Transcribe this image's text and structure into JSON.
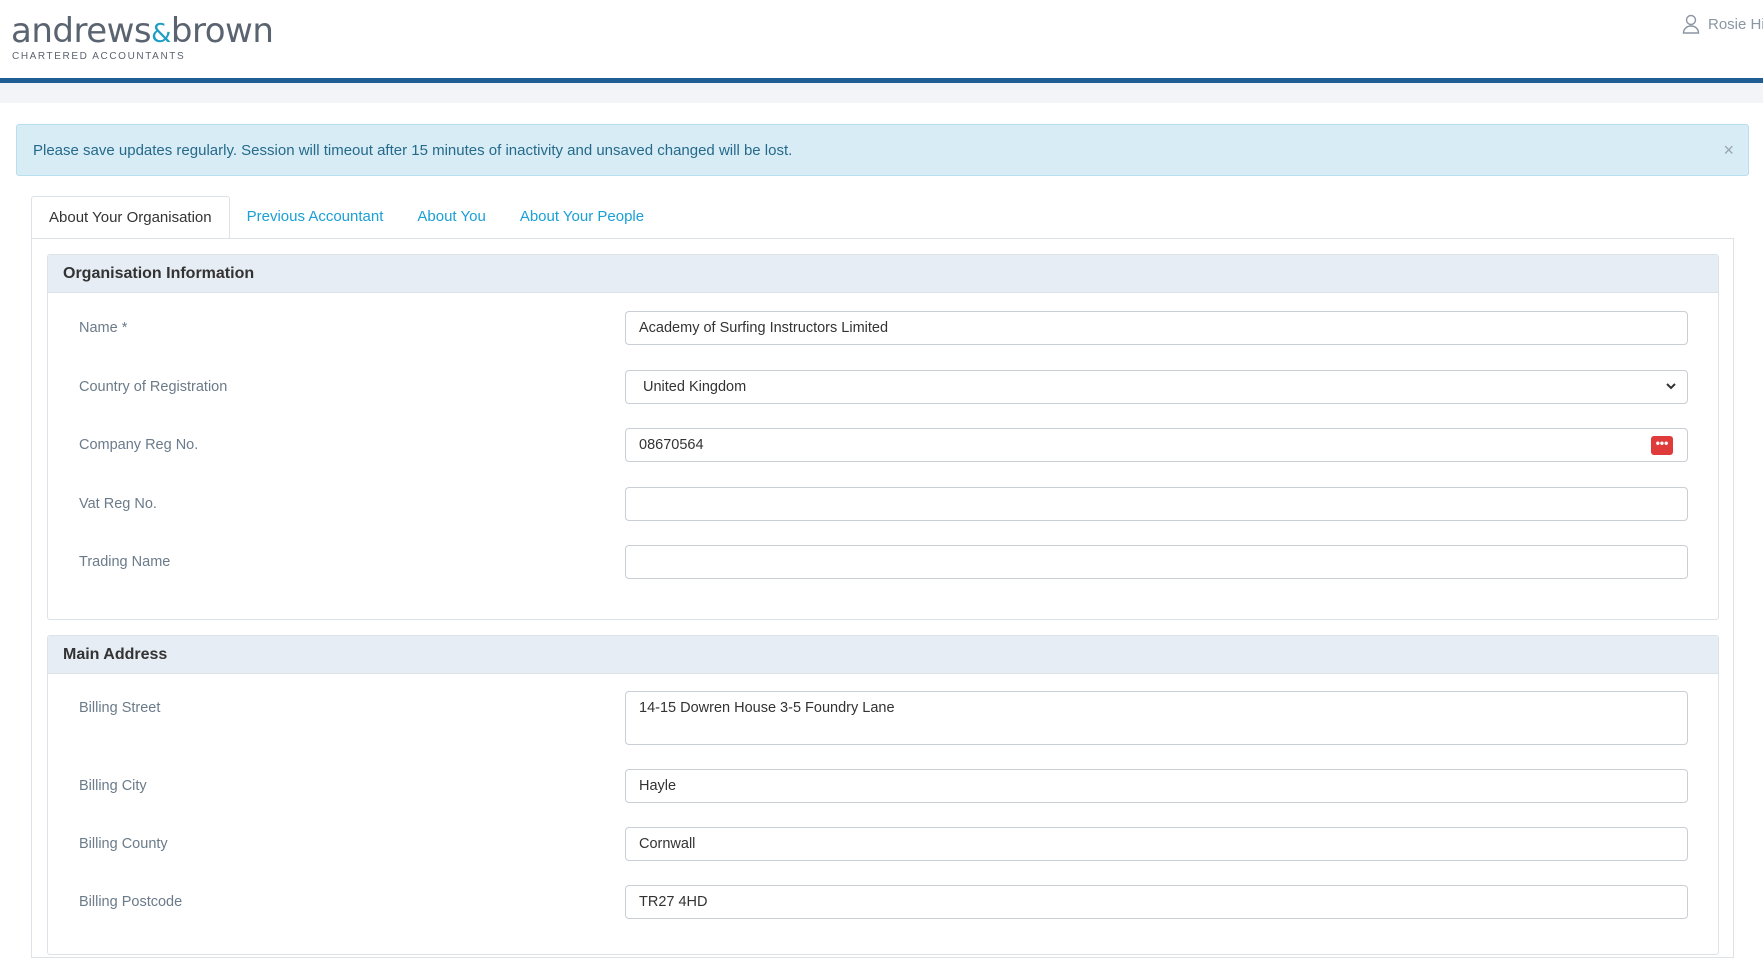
{
  "brand": {
    "name_part1": "andrews",
    "ampersand": "&",
    "name_part2": "brown",
    "tagline": "CHARTERED ACCOUNTANTS"
  },
  "user": {
    "name": "Rosie Hi"
  },
  "alert": {
    "message": "Please save updates regularly. Session will timeout after 15 minutes of inactivity and unsaved changed will be lost.",
    "close": "×"
  },
  "tabs": [
    {
      "label": "About Your Organisation",
      "active": true
    },
    {
      "label": "Previous Accountant"
    },
    {
      "label": "About You"
    },
    {
      "label": "About Your People"
    }
  ],
  "org_info": {
    "title": "Organisation Information",
    "name_label": "Name *",
    "name_value": "Academy of Surfing Instructors Limited",
    "country_label": "Country of Registration",
    "country_value": "United Kingdom",
    "company_reg_label": "Company Reg No.",
    "company_reg_value": "08670564",
    "company_reg_button": "•••",
    "vat_label": "Vat Reg No.",
    "vat_value": "",
    "trading_label": "Trading Name",
    "trading_value": ""
  },
  "main_address": {
    "title": "Main Address",
    "street_label": "Billing Street",
    "street_value": "14-15 Dowren House 3-5 Foundry Lane",
    "city_label": "Billing City",
    "city_value": "Hayle",
    "county_label": "Billing County",
    "county_value": "Cornwall",
    "postcode_label": "Billing Postcode",
    "postcode_value": "TR27 4HD"
  },
  "colors": {
    "brand_blue": "#1f5f95",
    "link": "#1a9fd6",
    "alert_bg": "#d8ecf6",
    "section_head_bg": "#e7edf4",
    "danger": "#e03b3b"
  }
}
